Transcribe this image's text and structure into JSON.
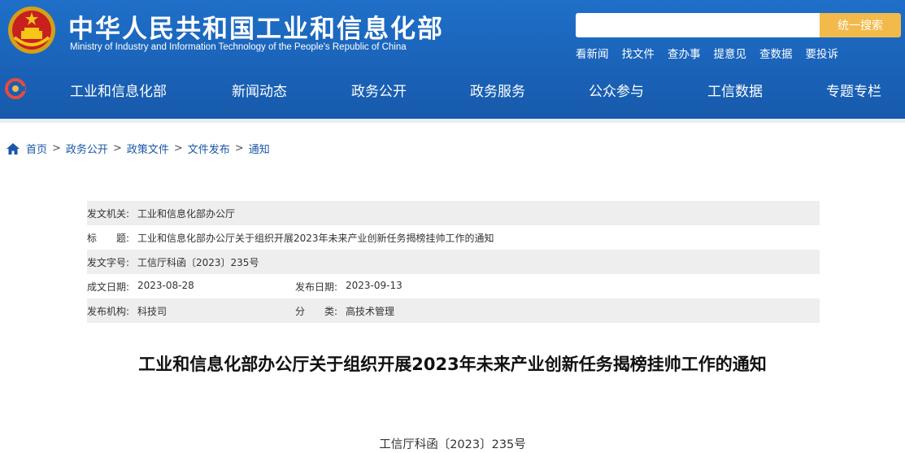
{
  "header": {
    "title": "中华人民共和国工业和信息化部",
    "subtitle": "Ministry of Industry and Information Technology of the People's Republic of China",
    "search": {
      "placeholder": "",
      "button_label": "统一搜索"
    },
    "quick_links": [
      "看新闻",
      "找文件",
      "查办事",
      "提意见",
      "查数据",
      "要投诉"
    ]
  },
  "nav": {
    "items": [
      "工业和信息化部",
      "新闻动态",
      "政务公开",
      "政务服务",
      "公众参与",
      "工信数据",
      "专题专栏"
    ]
  },
  "breadcrumb": [
    "首页",
    "政务公开",
    "政策文件",
    "文件发布",
    "通知"
  ],
  "meta": {
    "issuer_label": "发文机关:",
    "issuer": "工业和信息化部办公厅",
    "title_label": "标　　题:",
    "title": "工业和信息化部办公厅关于组织开展2023年未来产业创新任务揭榜挂帅工作的通知",
    "docno_label": "发文字号:",
    "docno": "工信厅科函〔2023〕235号",
    "date_label": "成文日期:",
    "date": "2023-08-28",
    "pubdate_label": "发布日期:",
    "pubdate": "2023-09-13",
    "org_label": "发布机构:",
    "org": "科技司",
    "category_label": "分　　类:",
    "category": "高技术管理"
  },
  "document": {
    "title": "工业和信息化部办公厅关于组织开展2023年未来产业创新任务揭榜挂帅工作的通知",
    "number": "工信厅科函〔2023〕235号"
  },
  "colors": {
    "header_blue": "#1a62b8",
    "search_button": "#f2ba4a",
    "link_blue": "#1a56a8"
  }
}
